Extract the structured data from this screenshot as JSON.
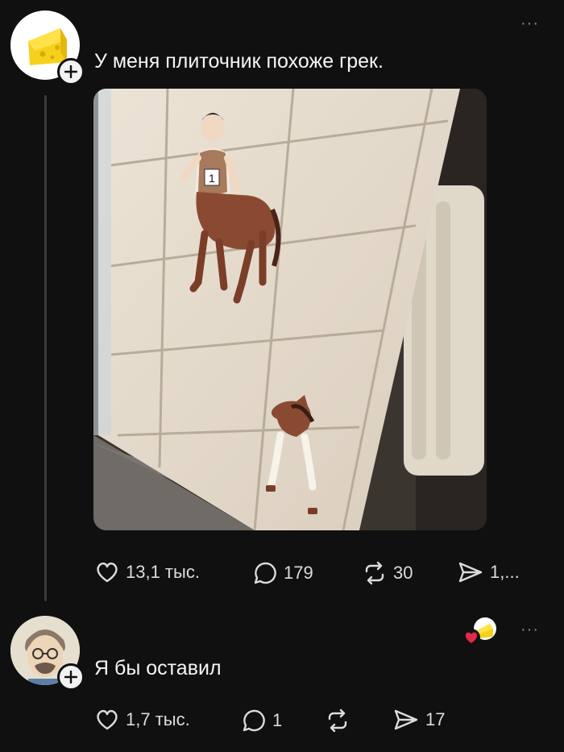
{
  "post": {
    "author_avatar": "cheese-avatar",
    "text": "У меня плиточник похоже грек.",
    "actions": {
      "likes": "13,1 тыс.",
      "replies": "179",
      "reposts": "30",
      "shares": "1,..."
    },
    "more": "···"
  },
  "reply": {
    "author_avatar": "man-cartoon-avatar",
    "text": "Я бы оставил",
    "liked_by_author_badge": "heart-cheese-badge",
    "actions": {
      "likes": "1,7 тыс.",
      "replies": "1",
      "reposts": "",
      "shares": "17"
    },
    "more": "···"
  },
  "image": {
    "description_icon": "tiles-photo",
    "tile_number": "1"
  },
  "colors": {
    "background": "#101010",
    "text": "#f3f3f3",
    "muted": "#8a8a8a",
    "heart": "#e0294b",
    "cheese": "#f6d11c"
  }
}
